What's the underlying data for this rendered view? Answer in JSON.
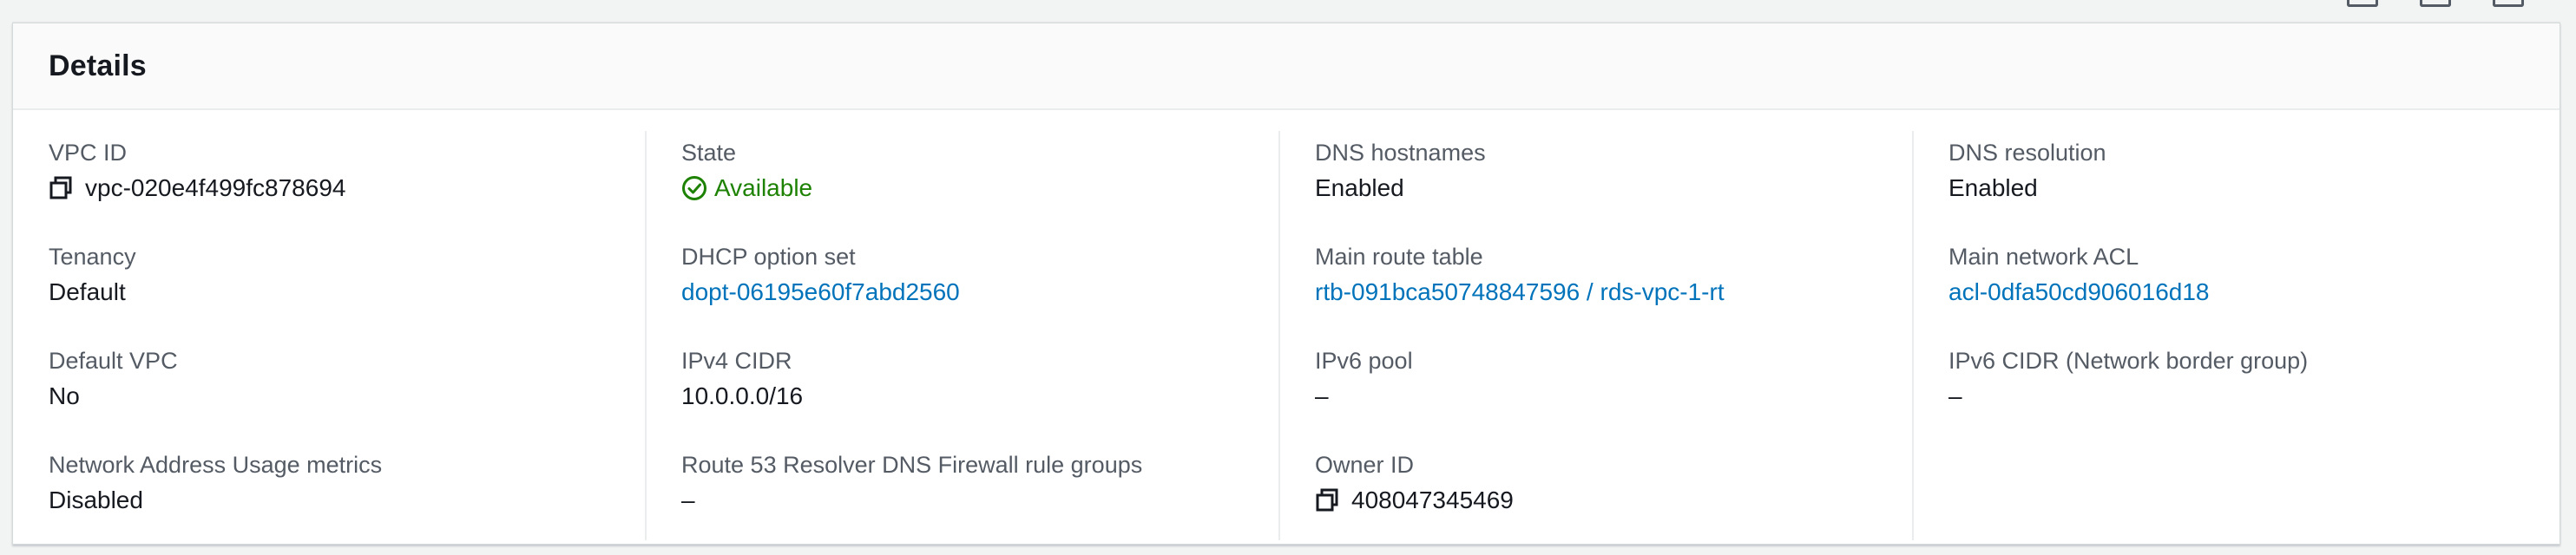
{
  "panel": {
    "title": "Details"
  },
  "columns": [
    [
      {
        "label": "VPC ID",
        "value": "vpc-020e4f499fc878694",
        "copy": true
      },
      {
        "label": "Tenancy",
        "value": "Default"
      },
      {
        "label": "Default VPC",
        "value": "No"
      },
      {
        "label": "Network Address Usage metrics",
        "value": "Disabled"
      }
    ],
    [
      {
        "label": "State",
        "value": "Available",
        "status": "available"
      },
      {
        "label": "DHCP option set",
        "value": "dopt-06195e60f7abd2560",
        "link": true
      },
      {
        "label": "IPv4 CIDR",
        "value": "10.0.0.0/16"
      },
      {
        "label": "Route 53 Resolver DNS Firewall rule groups",
        "value": "–"
      }
    ],
    [
      {
        "label": "DNS hostnames",
        "value": "Enabled"
      },
      {
        "label": "Main route table",
        "value": "rtb-091bca50748847596 / rds-vpc-1-rt",
        "link": true
      },
      {
        "label": "IPv6 pool",
        "value": "–"
      },
      {
        "label": "Owner ID",
        "value": "408047345469",
        "copy": true
      }
    ],
    [
      {
        "label": "DNS resolution",
        "value": "Enabled"
      },
      {
        "label": "Main network ACL",
        "value": "acl-0dfa50cd906016d18",
        "link": true
      },
      {
        "label": "IPv6 CIDR (Network border group)",
        "value": "–"
      }
    ]
  ],
  "icons": {
    "copy": "copy-icon",
    "status_available": "check-circle-icon"
  },
  "colors": {
    "link": "#0073bb",
    "success": "#1d8102",
    "label": "#545b64",
    "text": "#16191f"
  }
}
